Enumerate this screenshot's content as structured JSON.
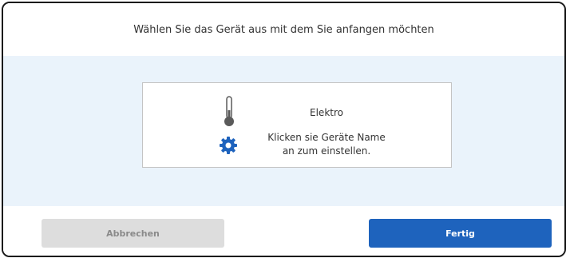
{
  "dialog": {
    "title": "Wählen Sie das Gerät aus mit dem Sie anfangen möchten"
  },
  "device_card": {
    "name": "Elektro",
    "description_line1": "Klicken sie Geräte Name",
    "description_line2": "an zum einstellen.",
    "icons": [
      "thermometer-icon",
      "gear-icon"
    ],
    "gear_color": "#1e63bd"
  },
  "footer": {
    "cancel_label": "Abbrechen",
    "done_label": "Fertig"
  },
  "colors": {
    "accent": "#1e63bd",
    "body_background": "#eaf3fb",
    "cancel_background": "#dddddd"
  }
}
